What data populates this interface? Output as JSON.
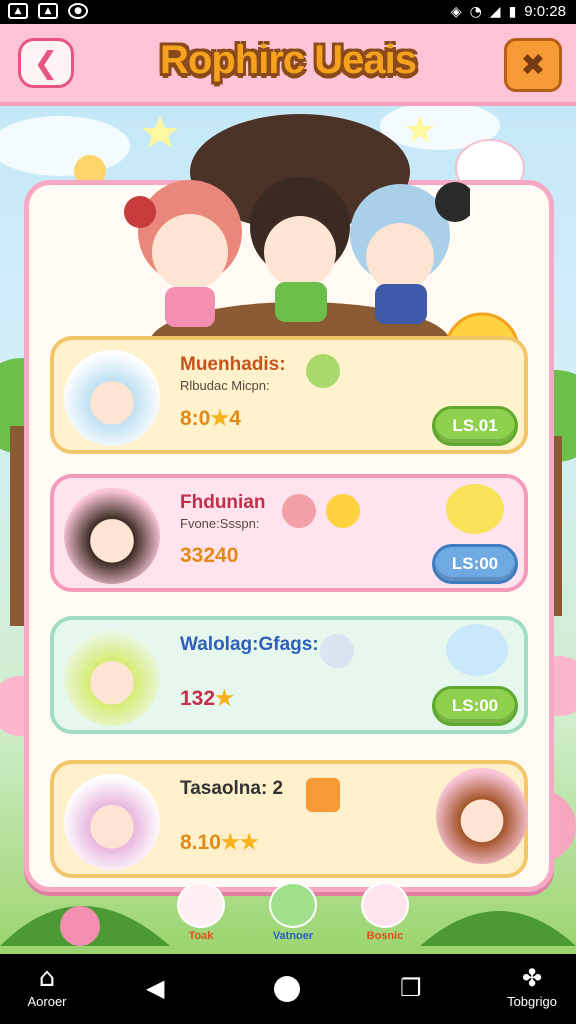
{
  "status_bar": {
    "time": "9:0:28",
    "icons": [
      "image-icon",
      "image-icon",
      "settings-icon",
      "vibrate-icon",
      "wifi-icon",
      "signal-icon",
      "battery-icon"
    ]
  },
  "header": {
    "title": "Rophirc Ueais",
    "back_icon": "back-arrow-icon",
    "close_icon": "close-x-icon"
  },
  "colors": {
    "accent_pink": "#fcc4d6",
    "title_orange": "#f7a21c",
    "button_green": "#8fd14f",
    "button_blue": "#6fa9e2"
  },
  "cards": [
    {
      "name": "Muenhadis:",
      "subtitle": "Rlbudac Micpn:",
      "score": "8:0",
      "score_tail": "4",
      "price": "LS.01",
      "button_color": "green",
      "name_color": "#c9541a"
    },
    {
      "name": "Fhdunian",
      "subtitle": "Fvone:Ssspn:",
      "score": "33240",
      "score_tail": "",
      "price": "LS:00",
      "button_color": "blue",
      "name_color": "#c0304a"
    },
    {
      "name": "Walolag:Gfags:",
      "subtitle": "",
      "score": "132",
      "score_tail": "",
      "price": "LS:00",
      "button_color": "green",
      "name_color": "#2f60b8"
    },
    {
      "name": "Tasaolna: 2",
      "subtitle": "",
      "score": "8.10",
      "score_tail": "",
      "price": "",
      "button_color": "",
      "name_color": "#333333"
    }
  ],
  "bottom_tabs": [
    {
      "label": "Toak",
      "icon": "bunny-icon",
      "color": "#e0501e"
    },
    {
      "label": "Vatnoer",
      "icon": "slime-icon",
      "color": "#2f60b8"
    },
    {
      "label": "Bosnic",
      "icon": "bear-icon",
      "color": "#e0501e"
    }
  ],
  "nav_bar": {
    "home_label": "Aoroer",
    "right_label": "Tobgrigo"
  }
}
